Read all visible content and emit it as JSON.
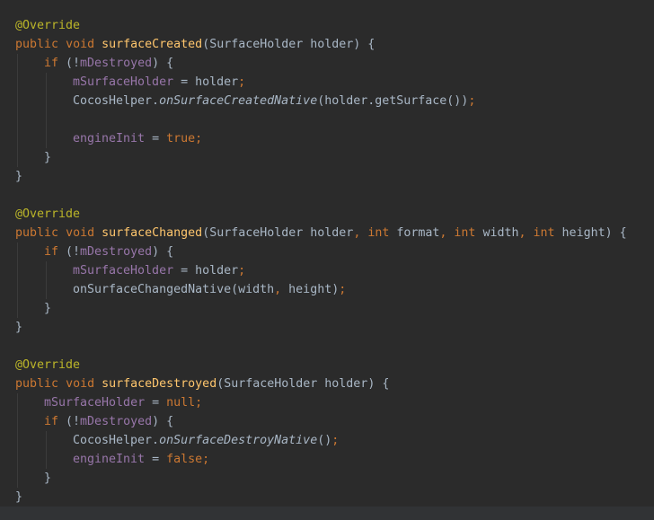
{
  "theme": {
    "background": "#2b2b2b",
    "default_text": "#a9b7c6",
    "annotation": "#bbb529",
    "keyword": "#cc7832",
    "method_declaration": "#ffc66d",
    "field": "#9876aa",
    "indent_guide": "#3b3b3b",
    "bottom_bar": "#313335"
  },
  "code": {
    "lines": [
      {
        "indent": 0,
        "tokens": [
          {
            "t": "@Override",
            "k": "annotation"
          }
        ]
      },
      {
        "indent": 0,
        "tokens": [
          {
            "t": "public",
            "k": "keyword"
          },
          {
            "t": " ",
            "k": "plain"
          },
          {
            "t": "void",
            "k": "keyword"
          },
          {
            "t": " ",
            "k": "plain"
          },
          {
            "t": "surfaceCreated",
            "k": "method"
          },
          {
            "t": "(SurfaceHolder holder) {",
            "k": "plain"
          }
        ]
      },
      {
        "indent": 1,
        "tokens": [
          {
            "t": "if",
            "k": "keyword"
          },
          {
            "t": " (!",
            "k": "plain"
          },
          {
            "t": "mDestroyed",
            "k": "field"
          },
          {
            "t": ") {",
            "k": "plain"
          }
        ]
      },
      {
        "indent": 2,
        "tokens": [
          {
            "t": "mSurfaceHolder",
            "k": "field"
          },
          {
            "t": " = holder",
            "k": "plain"
          },
          {
            "t": ";",
            "k": "punct"
          }
        ]
      },
      {
        "indent": 2,
        "tokens": [
          {
            "t": "CocosHelper.",
            "k": "plain"
          },
          {
            "t": "onSurfaceCreatedNative",
            "k": "italic"
          },
          {
            "t": "(holder.getSurface())",
            "k": "plain"
          },
          {
            "t": ";",
            "k": "punct"
          }
        ]
      },
      {
        "indent": 2,
        "tokens": []
      },
      {
        "indent": 2,
        "tokens": [
          {
            "t": "engineInit",
            "k": "field"
          },
          {
            "t": " = ",
            "k": "plain"
          },
          {
            "t": "true",
            "k": "keyword"
          },
          {
            "t": ";",
            "k": "punct"
          }
        ]
      },
      {
        "indent": 1,
        "tokens": [
          {
            "t": "}",
            "k": "plain"
          }
        ]
      },
      {
        "indent": 0,
        "tokens": [
          {
            "t": "}",
            "k": "plain"
          }
        ]
      },
      {
        "indent": 0,
        "tokens": []
      },
      {
        "indent": 0,
        "tokens": [
          {
            "t": "@Override",
            "k": "annotation"
          }
        ]
      },
      {
        "indent": 0,
        "tokens": [
          {
            "t": "public",
            "k": "keyword"
          },
          {
            "t": " ",
            "k": "plain"
          },
          {
            "t": "void",
            "k": "keyword"
          },
          {
            "t": " ",
            "k": "plain"
          },
          {
            "t": "surfaceChanged",
            "k": "method"
          },
          {
            "t": "(SurfaceHolder holder",
            "k": "plain"
          },
          {
            "t": ", ",
            "k": "punct"
          },
          {
            "t": "int",
            "k": "keyword"
          },
          {
            "t": " format",
            "k": "plain"
          },
          {
            "t": ", ",
            "k": "punct"
          },
          {
            "t": "int",
            "k": "keyword"
          },
          {
            "t": " width",
            "k": "plain"
          },
          {
            "t": ", ",
            "k": "punct"
          },
          {
            "t": "int",
            "k": "keyword"
          },
          {
            "t": " height) {",
            "k": "plain"
          }
        ]
      },
      {
        "indent": 1,
        "tokens": [
          {
            "t": "if",
            "k": "keyword"
          },
          {
            "t": " (!",
            "k": "plain"
          },
          {
            "t": "mDestroyed",
            "k": "field"
          },
          {
            "t": ") {",
            "k": "plain"
          }
        ]
      },
      {
        "indent": 2,
        "tokens": [
          {
            "t": "mSurfaceHolder",
            "k": "field"
          },
          {
            "t": " = holder",
            "k": "plain"
          },
          {
            "t": ";",
            "k": "punct"
          }
        ]
      },
      {
        "indent": 2,
        "tokens": [
          {
            "t": "onSurfaceChangedNative(width",
            "k": "plain"
          },
          {
            "t": ", ",
            "k": "punct"
          },
          {
            "t": "height)",
            "k": "plain"
          },
          {
            "t": ";",
            "k": "punct"
          }
        ]
      },
      {
        "indent": 1,
        "tokens": [
          {
            "t": "}",
            "k": "plain"
          }
        ]
      },
      {
        "indent": 0,
        "tokens": [
          {
            "t": "}",
            "k": "plain"
          }
        ]
      },
      {
        "indent": 0,
        "tokens": []
      },
      {
        "indent": 0,
        "tokens": [
          {
            "t": "@Override",
            "k": "annotation"
          }
        ]
      },
      {
        "indent": 0,
        "tokens": [
          {
            "t": "public",
            "k": "keyword"
          },
          {
            "t": " ",
            "k": "plain"
          },
          {
            "t": "void",
            "k": "keyword"
          },
          {
            "t": " ",
            "k": "plain"
          },
          {
            "t": "surfaceDestroyed",
            "k": "method"
          },
          {
            "t": "(SurfaceHolder holder) {",
            "k": "plain"
          }
        ]
      },
      {
        "indent": 1,
        "tokens": [
          {
            "t": "mSurfaceHolder",
            "k": "field"
          },
          {
            "t": " = ",
            "k": "plain"
          },
          {
            "t": "null",
            "k": "keyword"
          },
          {
            "t": ";",
            "k": "punct"
          }
        ]
      },
      {
        "indent": 1,
        "tokens": [
          {
            "t": "if",
            "k": "keyword"
          },
          {
            "t": " (!",
            "k": "plain"
          },
          {
            "t": "mDestroyed",
            "k": "field"
          },
          {
            "t": ") {",
            "k": "plain"
          }
        ]
      },
      {
        "indent": 2,
        "tokens": [
          {
            "t": "CocosHelper.",
            "k": "plain"
          },
          {
            "t": "onSurfaceDestroyNative",
            "k": "italic"
          },
          {
            "t": "()",
            "k": "plain"
          },
          {
            "t": ";",
            "k": "punct"
          }
        ]
      },
      {
        "indent": 2,
        "tokens": [
          {
            "t": "engineInit",
            "k": "field"
          },
          {
            "t": " = ",
            "k": "plain"
          },
          {
            "t": "false",
            "k": "keyword"
          },
          {
            "t": ";",
            "k": "punct"
          }
        ]
      },
      {
        "indent": 1,
        "tokens": [
          {
            "t": "}",
            "k": "plain"
          }
        ]
      },
      {
        "indent": 0,
        "tokens": [
          {
            "t": "}",
            "k": "plain"
          }
        ]
      }
    ]
  }
}
